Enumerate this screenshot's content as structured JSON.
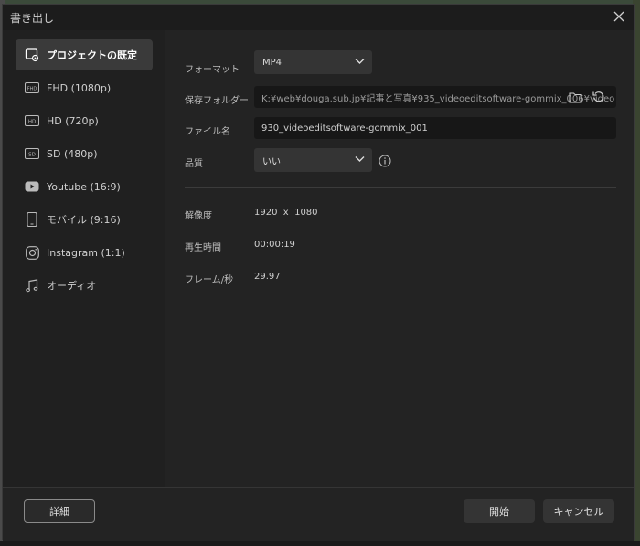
{
  "dialog": {
    "title": "書き出し"
  },
  "sidebar": {
    "items": [
      {
        "label": "プロジェクトの既定",
        "icon": "project-settings-icon",
        "active": true
      },
      {
        "label": "FHD (1080p)",
        "icon": "fhd-icon"
      },
      {
        "label": "HD (720p)",
        "icon": "hd-icon"
      },
      {
        "label": "SD (480p)",
        "icon": "sd-icon"
      },
      {
        "label": "Youtube (16:9)",
        "icon": "youtube-icon"
      },
      {
        "label": "モバイル (9:16)",
        "icon": "mobile-icon"
      },
      {
        "label": "Instagram (1:1)",
        "icon": "instagram-icon"
      },
      {
        "label": "オーディオ",
        "icon": "music-note-icon"
      }
    ],
    "badges": {
      "fhd": "FHD",
      "hd": "HD",
      "sd": "SD"
    }
  },
  "settings": {
    "format_label": "フォーマット",
    "format_value": "MP4",
    "folder_label": "保存フォルダー",
    "folder_value": "K:¥web¥douga.sub.jp¥記事と写真¥935_videoeditsoftware-gommix_006¥video",
    "filename_label": "ファイル名",
    "filename_value": "930_videoeditsoftware-gommix_001",
    "quality_label": "品質",
    "quality_value": "いい"
  },
  "info": {
    "resolution_label": "解像度",
    "resolution_value": "1920  x  1080",
    "duration_label": "再生時間",
    "duration_value": "00:00:19",
    "fps_label": "フレーム/秒",
    "fps_value": "29.97"
  },
  "footer": {
    "details_label": "詳細",
    "start_label": "開始",
    "cancel_label": "キャンセル"
  },
  "colors": {
    "dialog_bg": "#232323",
    "active_item": "#3a3a3a",
    "field_bg": "#171717"
  }
}
